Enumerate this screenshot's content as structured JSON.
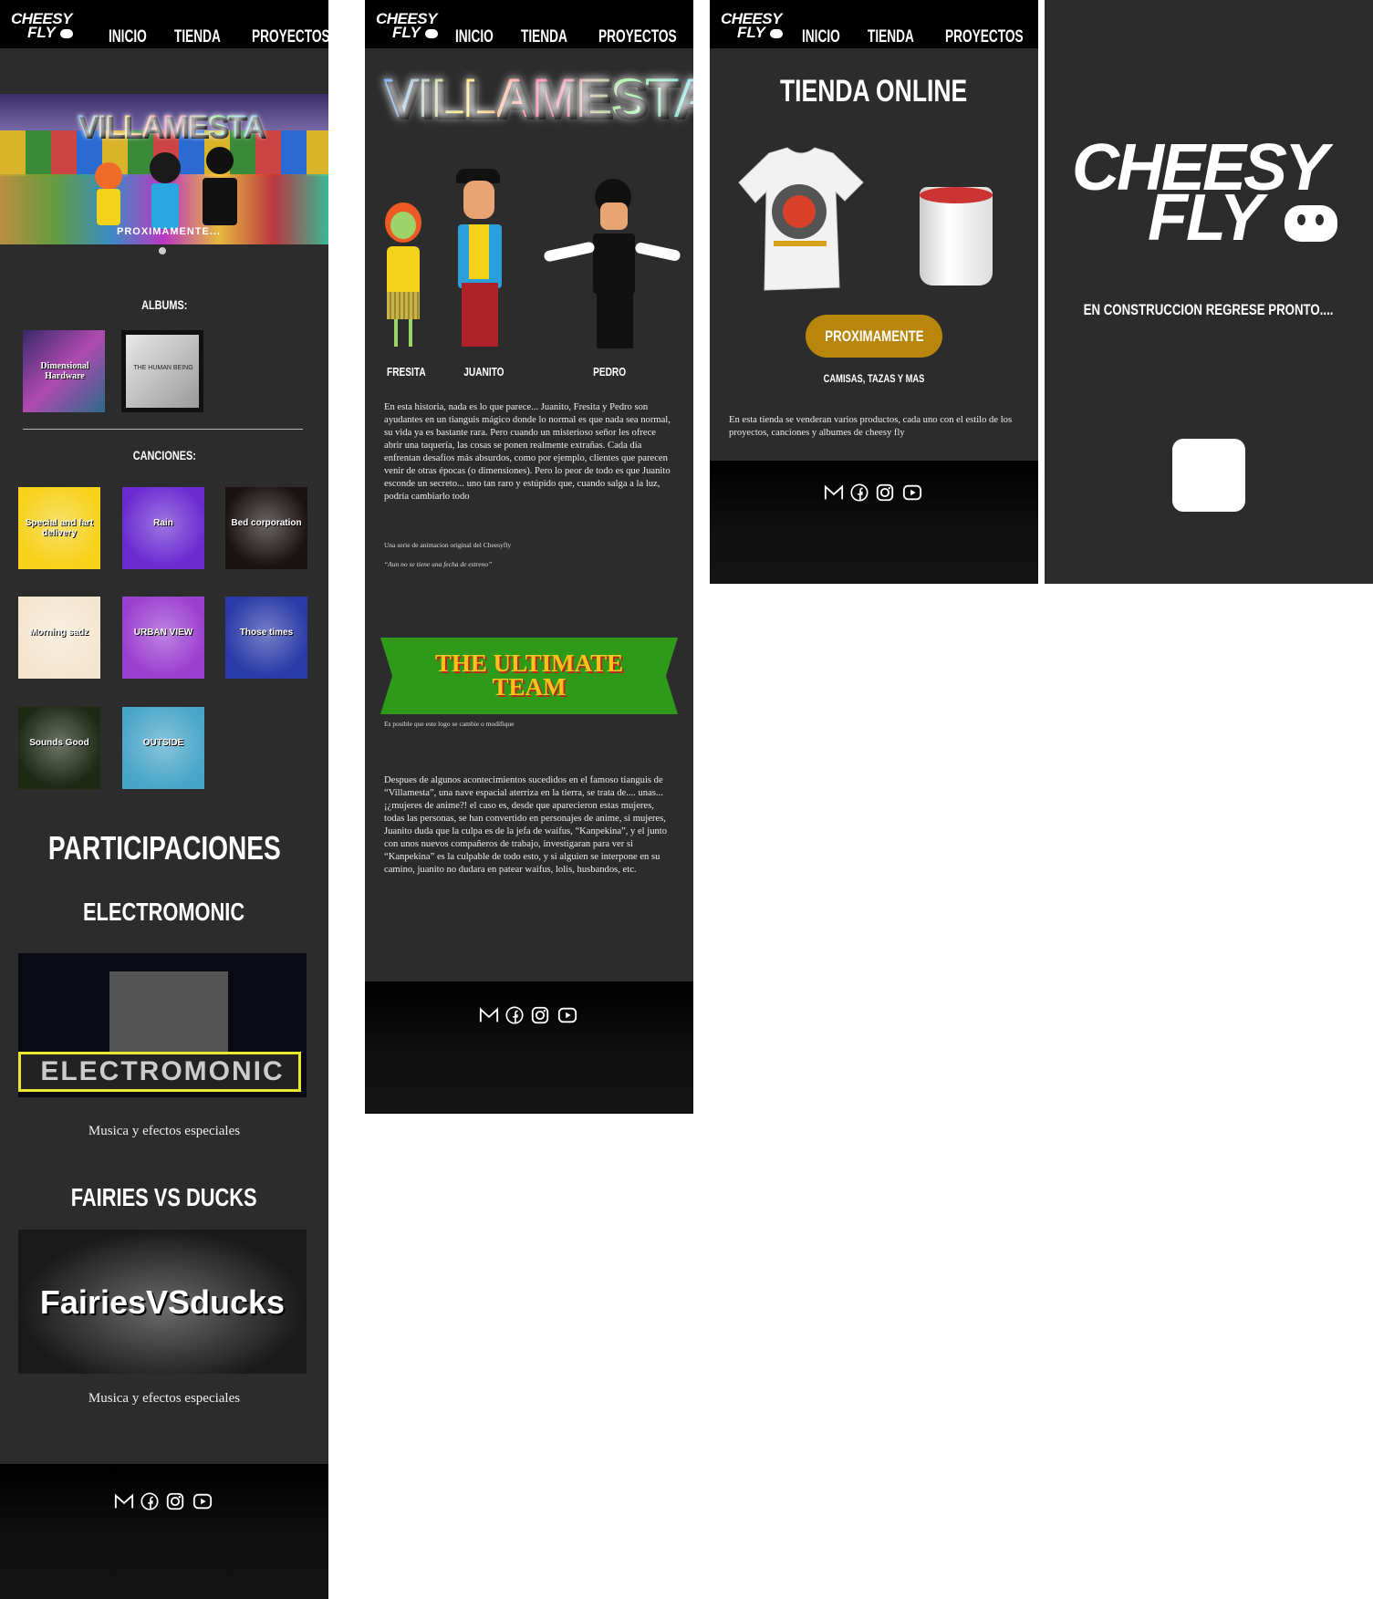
{
  "nav": {
    "home": "INICIO",
    "shop": "TIENDA",
    "projects": "PROYECTOS"
  },
  "logo": {
    "line1": "CHEESY",
    "line2": "FLY"
  },
  "home": {
    "hero": {
      "title": "VILLAMESTA",
      "tagline": "PROXIMAMENTE..."
    },
    "albums_heading": "ALBUMS:",
    "albums": [
      {
        "title": "Dimensional Hardware"
      },
      {
        "title": "THE HUMAN BEING"
      }
    ],
    "songs_heading": "CANCIONES:",
    "songs": [
      {
        "title": "Special and fart delivery",
        "color": "#f7d11a"
      },
      {
        "title": "Rain",
        "color": "#6a2bd1"
      },
      {
        "title": "Bed corporation",
        "color": "#1a1210"
      },
      {
        "title": "Morning sadz",
        "color": "#f5e6cf"
      },
      {
        "title": "URBAN VIEW",
        "color": "#9b3fd0"
      },
      {
        "title": "Those times",
        "color": "#2a3aa8"
      },
      {
        "title": "Sounds Good",
        "color": "#1e2a14"
      },
      {
        "title": "OUTSIDE",
        "color": "#4aa6c9"
      }
    ],
    "participations_heading": "PARTICIPACIONES",
    "groups": [
      {
        "name": "ELECTROMONIC",
        "banner_text": "ELECTROMONIC",
        "caption": "Musica y efectos especiales"
      },
      {
        "name": "FAIRIES VS DUCKS",
        "banner_text": "FairiesVSducks",
        "caption": "Musica y efectos especiales"
      }
    ]
  },
  "villamesta": {
    "title": "VILLAMESTA",
    "characters": [
      {
        "name": "FRESITA"
      },
      {
        "name": "JUANITO"
      },
      {
        "name": "PEDRO"
      }
    ],
    "synopsis": "En esta historia, nada es lo que parece... Juanito, Fresita y Pedro son ayudantes en un tianguis mágico donde lo normal es que nada sea normal, su vida ya es bastante rara. Pero cuando un misterioso señor les ofrece abrir una taquería, las cosas se ponen realmente extrañas. Cada día enfrentan desafíos más absurdos, como por ejemplo, clientes que parecen venir de otras épocas (o dimensiones). Pero lo peor de todo es que Juanito esconde un secreto... uno tan raro y estúpido  que, cuando salga a la luz, podría cambiarlo todo",
    "note1": "Una serie de animacion original del Cheesyfly",
    "note2": "“Aun no se tiene una fecha de estreno”",
    "ultimate_team": {
      "line1": "THE ULTIMATE",
      "line2": "TEAM"
    },
    "logo_note": "Es posible que este logo se cambie o modifique",
    "story": "Despues de algunos acontecimientos sucedidos en el famoso tianguis de “Villamesta”, una nave espacial aterriza en la tierra, se trata de.... unas...  ¡¿mujeres de anime?!  el caso es, desde que aparecieron estas mujeres, todas las personas, se han convertido en personajes de anime, si mujeres, Juanito duda que la culpa es de la jefa de waifus, “Kanpekina”, y el junto con unos nuevos compañeros de trabajo, investigaran para ver si “Kanpekina” es la culpable de todo esto, y si alguien se interpone en su camino, juanito no dudara en patear waifus, lolis, husbandos, etc."
  },
  "shop": {
    "title": "TIENDA ONLINE",
    "button": "PROXIMAMENTE",
    "subtitle": "CAMISAS, TAZAS Y MAS",
    "description": "En esta tienda se venderan varios productos, cada uno con el estilo de los proyectos, canciones y albumes de cheesy fly"
  },
  "construction": {
    "logo_line1": "CHEESY",
    "logo_line2": "FLY",
    "message": "EN CONSTRUCCION REGRESE PRONTO...."
  },
  "socials": [
    "gmail-icon",
    "facebook-icon",
    "instagram-icon",
    "youtube-icon"
  ],
  "colors": {
    "panel_bg": "#2c2c2c",
    "header_bg": "#000000",
    "button": "#b8860b"
  }
}
